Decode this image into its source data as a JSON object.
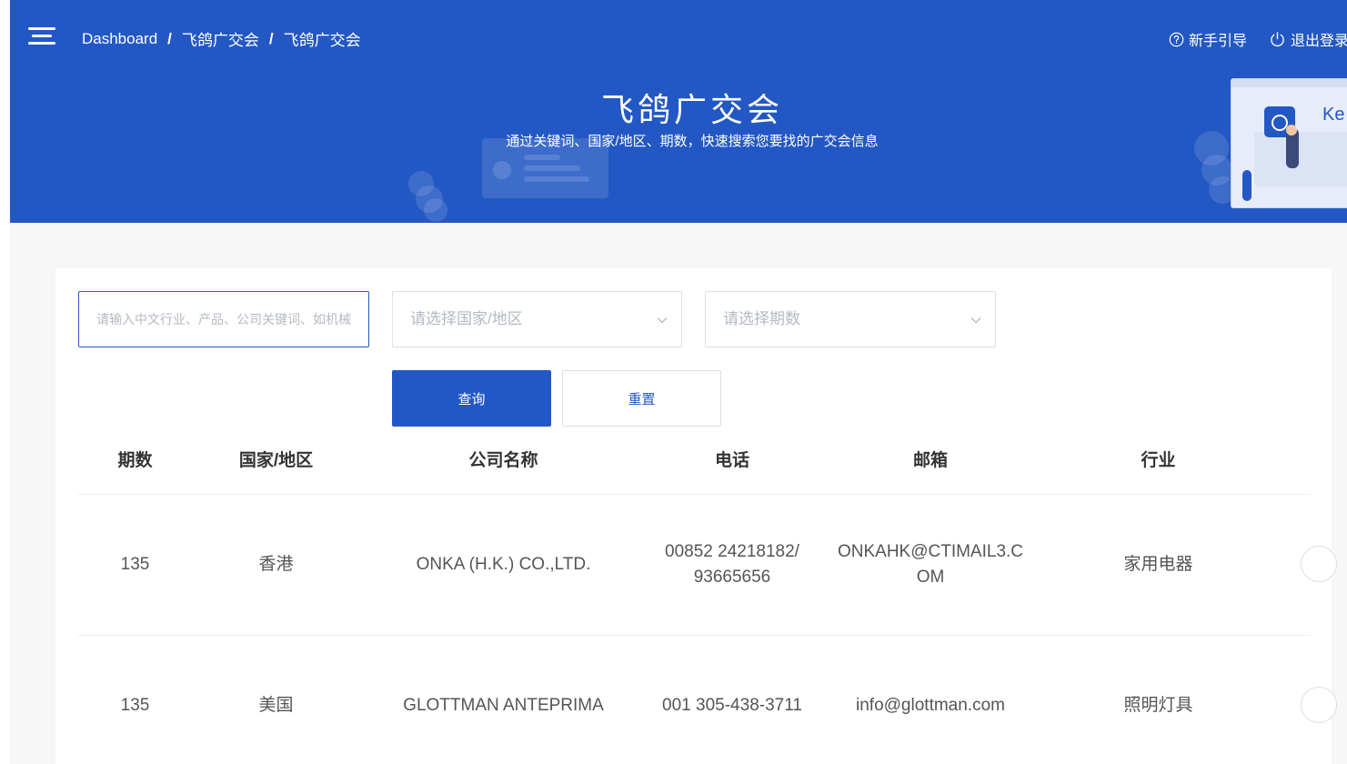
{
  "breadcrumb": [
    "Dashboard",
    "飞鸽广交会",
    "飞鸽广交会"
  ],
  "breadcrumb_sep": "/",
  "top_actions": {
    "guide": "新手引导",
    "logout": "退出登录"
  },
  "banner": {
    "title": "飞鸽广交会",
    "subtitle": "通过关键词、国家/地区、期数，快速搜索您要找的广交会信息",
    "illustration_text": "Ke"
  },
  "search": {
    "keyword_placeholder": "请输入中文行业、产品、公司关键词、如机械",
    "country_placeholder": "请选择国家/地区",
    "period_placeholder": "请选择期数",
    "query_label": "查询",
    "reset_label": "重置"
  },
  "table": {
    "headers": [
      "期数",
      "国家/地区",
      "公司名称",
      "电话",
      "邮箱",
      "行业"
    ],
    "rows": [
      {
        "period": "135",
        "country": "香港",
        "company": "ONKA (H.K.) CO.,LTD.",
        "phone": "00852 24218182/ 93665656",
        "email": "ONKAHK@CTIMAIL3.COM",
        "industry": "家用电器"
      },
      {
        "period": "135",
        "country": "美国",
        "company": "GLOTTMAN ANTEPRIMA",
        "phone": "001 305-438-3711",
        "email": "info@glottman.com",
        "industry": "照明灯具"
      }
    ]
  },
  "colors": {
    "primary": "#2358c4",
    "background": "#f7f7f7",
    "text": "#555555",
    "header_text": "#333333"
  },
  "icons": {
    "menu": "menu-icon",
    "guide": "question-circle-icon",
    "logout": "power-icon",
    "dropdown": "chevron-down-icon"
  }
}
